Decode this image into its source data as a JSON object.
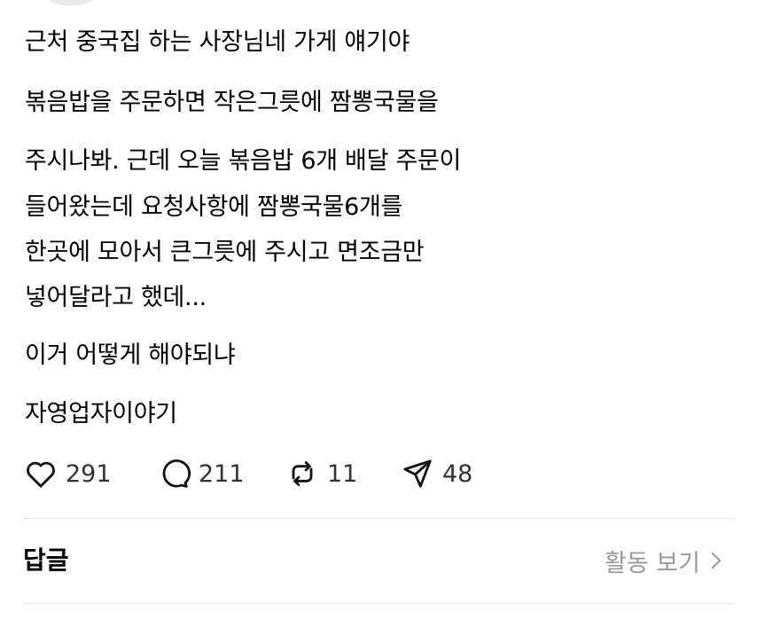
{
  "post": {
    "paragraphs": [
      [
        "근처 중국집 하는 사장님네 가게 얘기야"
      ],
      [
        "볶음밥을 주문하면 작은그릇에 짬뽕국물을"
      ],
      [
        "주시나봐. 근데 오늘 볶음밥 6개 배달 주문이",
        "들어왔는데 요청사항에 짬뽕국물6개를",
        "한곳에 모아서 큰그릇에 주시고 면조금만",
        "넣어달라고 했데..."
      ],
      [
        "이거 어떻게 해야되냐"
      ],
      [
        "자영업자이야기"
      ]
    ]
  },
  "actions": {
    "likes": "291",
    "comments": "211",
    "reposts": "11",
    "shares": "48"
  },
  "replies": {
    "title": "답글",
    "activity_label": "활동 보기"
  },
  "colors": {
    "text": "#000000",
    "muted": "#999999",
    "divider": "#e6e6e6"
  },
  "icons": [
    "heart-icon",
    "comment-icon",
    "repost-icon",
    "share-icon",
    "chevron-right-icon"
  ]
}
